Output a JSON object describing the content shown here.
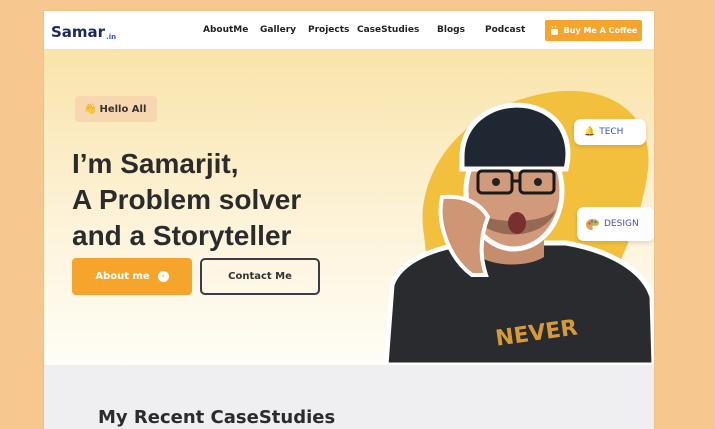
{
  "nav": {
    "logo": "Samar",
    "logo_suffix": ".in",
    "items": [
      "AboutMe",
      "Gallery",
      "Projects",
      "CaseStudies",
      "Blogs",
      "Podcast"
    ],
    "cta_label": "Buy Me A Coffee"
  },
  "hero": {
    "badge_icon": "👋",
    "badge_label": "Hello All",
    "headline": [
      "I’m Samarjit,",
      "A Problem solver",
      "and a Storyteller"
    ],
    "primary_button": "About me",
    "secondary_button": "Contact Me",
    "chips": [
      {
        "icon": "🔔",
        "label": "TECH"
      },
      {
        "icon": "palette-icon",
        "label": "DESIGN"
      }
    ]
  },
  "section": {
    "title": "My Recent CaseStudies"
  },
  "colors": {
    "accent": "#f5a52b",
    "blob": "#f3c03d",
    "page_bg": "#f6c78f",
    "headline": "#2b2b2b",
    "logo": "#1c2a54"
  }
}
